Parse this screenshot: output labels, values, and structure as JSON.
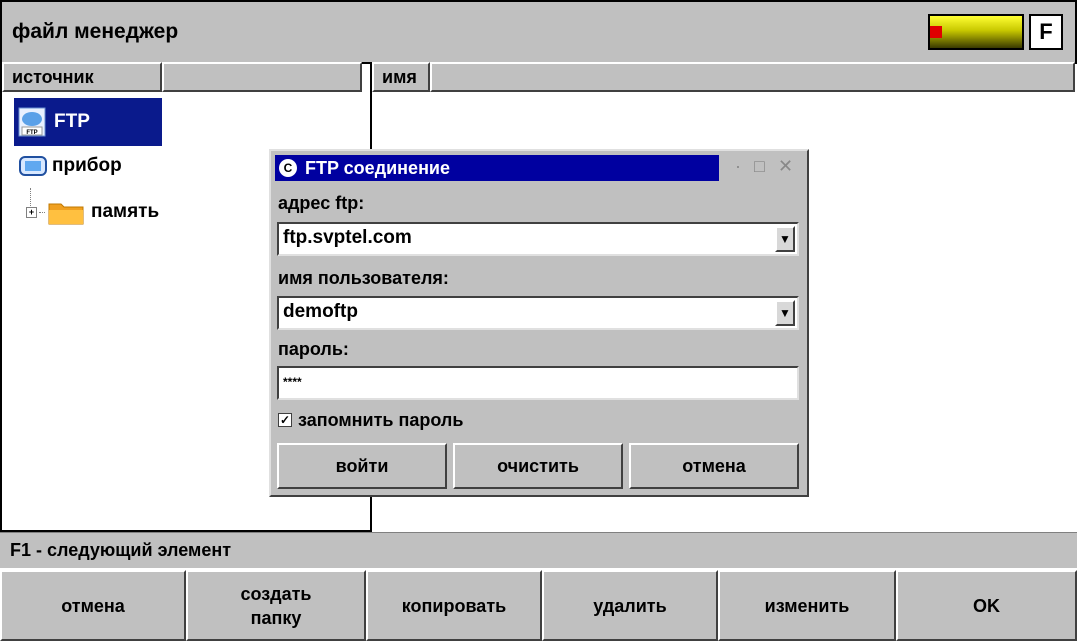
{
  "header": {
    "title": "файл менеджер",
    "f_key": "F"
  },
  "left_panel": {
    "column_header": "источник",
    "tree": [
      {
        "label": "FTP",
        "icon": "ftp-icon",
        "icon_text": "FTP",
        "selected": true
      },
      {
        "label": "прибор",
        "icon": "device-icon"
      },
      {
        "label": "память",
        "icon": "folder-icon",
        "expander": "+"
      }
    ]
  },
  "right_panel": {
    "column_header": "имя"
  },
  "dialog": {
    "title": "FTP соединение",
    "app_icon": "C",
    "controls": {
      "minimize": "·",
      "maximize": "□",
      "close": "✕"
    },
    "address_label": "адрес ftp:",
    "address_value": "ftp.svptel.com",
    "user_label": "имя пользователя:",
    "user_value": "demoftp",
    "password_label": "пароль:",
    "password_value": "****",
    "remember_label": "запомнить пароль",
    "remember_checked": true,
    "buttons": {
      "login": "войти",
      "clear": "очистить",
      "cancel": "отмена"
    }
  },
  "status": {
    "text": "F1 - следующий элемент"
  },
  "footer_buttons": [
    "отмена",
    "создать\nпапку",
    "копировать",
    "удалить",
    "изменить",
    "OK"
  ],
  "colors": {
    "selection": "#0a1a8c",
    "panel_gray": "#c0c0c0",
    "dialog_title": "#0000a0"
  }
}
